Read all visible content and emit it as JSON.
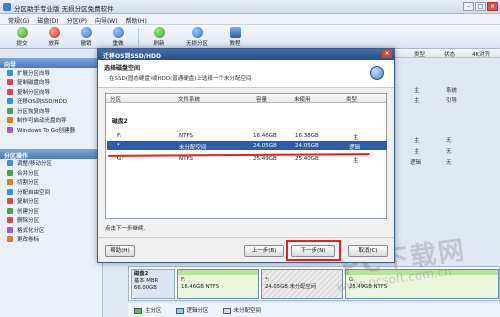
{
  "app": {
    "title": "分区助手专业版   无损分区免费软件"
  },
  "menu": [
    "常规(G)",
    "磁盘(D)",
    "分区(P)",
    "向导(W)",
    "帮助(H)"
  ],
  "toolbar": [
    {
      "label": "提交",
      "icon": "commit-icon"
    },
    {
      "label": "放弃",
      "icon": "discard-icon"
    },
    {
      "label": "撤销",
      "icon": "undo-icon"
    },
    {
      "label": "重做",
      "icon": "redo-icon"
    },
    {
      "label": "刷新",
      "icon": "refresh-icon"
    },
    {
      "label": "无损分区",
      "icon": "lossless-partition-icon"
    },
    {
      "label": "教程",
      "icon": "tutorial-icon"
    }
  ],
  "columns_right": {
    "type": "类型",
    "status": "状态",
    "flag": "4K对齐"
  },
  "sidebar": {
    "wizard_title": "向导",
    "wizard_items": [
      "扩展分区向导",
      "复制磁盘向导",
      "复制分区向导",
      "迁移OS到SSD/HDD",
      "分区恢复向导",
      "制作可启动光盘向导",
      "Windows To Go创建器"
    ],
    "ops_title": "分区操作",
    "ops_items": [
      "调整/移动分区",
      "合并分区",
      "切割分区",
      "分配自由空间",
      "复制分区",
      "创建分区",
      "删除分区",
      "格式化分区",
      "更改卷标"
    ]
  },
  "right_rows": [
    "主",
    "系统",
    "主",
    "引导",
    "主",
    "无",
    "主",
    "无",
    "逻辑",
    "无"
  ],
  "dialog": {
    "title": "迁移OS到SSD/HDD",
    "header_title": "选择磁盘空间",
    "header_desc": "在SSD(固态硬盘)或HDD(普通硬盘)上选择一个未分配空间",
    "columns": {
      "part": "分区",
      "fs": "文件系统",
      "cap": "容量",
      "unused": "未使用",
      "type": "类型"
    },
    "disk_label": "磁盘2",
    "rows": [
      {
        "part": "F:",
        "fs": "NTFS",
        "cap": "16.46GB",
        "unused": "16.38GB",
        "type": "主"
      },
      {
        "part": "*",
        "fs": "未分配空间",
        "cap": "24.05GB",
        "unused": "24.05GB",
        "type": "逻辑"
      },
      {
        "part": "G:",
        "fs": "NTFS",
        "cap": "25.49GB",
        "unused": "25.40GB",
        "type": "主"
      }
    ],
    "hint": "点击下一步继续.",
    "buttons": {
      "help": "帮助(H)",
      "back": "上一步(B)",
      "next": "下一步(N)",
      "cancel": "取消(C)"
    }
  },
  "disk_bar": {
    "name": "磁盘2",
    "kind": "基本 MBR",
    "size": "66.00GB",
    "p1_label": "F:",
    "p1_size": "16.46GB NTFS",
    "p2_label": "*:",
    "p2_size": "24.05GB 未分配空间",
    "p3_label": "G:",
    "p3_size": "25.49GB NTFS"
  },
  "legend": [
    "主分区",
    "逻辑分区",
    "未分配空间"
  ],
  "watermark": {
    "big": "PC下载网",
    "small": "www.pcsoft.com.cn"
  },
  "colors": {
    "title_blue": "#264f86",
    "select_blue": "#2b5ea6",
    "highlight_red": "#e0231d"
  }
}
